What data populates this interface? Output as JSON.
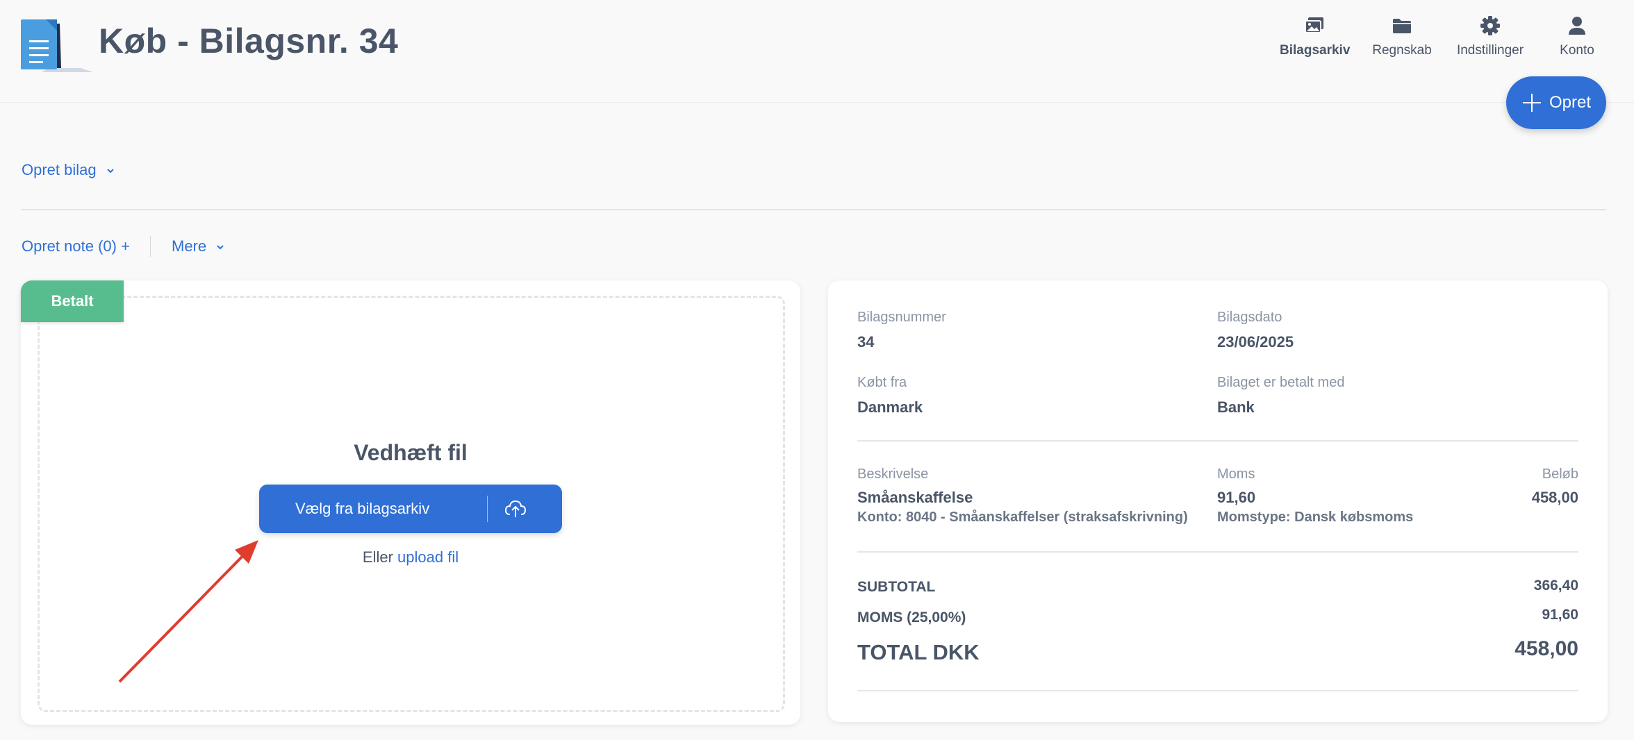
{
  "header": {
    "title": "Køb - Bilagsnr. 34",
    "nav": [
      {
        "label": "Bilagsarkiv",
        "icon": "images-icon",
        "active": true
      },
      {
        "label": "Regnskab",
        "icon": "folder-icon",
        "active": false
      },
      {
        "label": "Indstillinger",
        "icon": "gear-icon",
        "active": false
      },
      {
        "label": "Konto",
        "icon": "user-icon",
        "active": false
      }
    ]
  },
  "fab": {
    "label": "Opret",
    "icon": "plus-icon"
  },
  "toolbar": {
    "create_voucher": "Opret bilag",
    "create_note": "Opret note (0) +",
    "more": "Mere"
  },
  "attachment": {
    "status_badge": "Betalt",
    "title": "Vedhæft fil",
    "choose_button": "Vælg fra bilagsarkiv",
    "upload_prefix": "Eller",
    "upload_link": "upload fil"
  },
  "details": {
    "voucher_number_label": "Bilagsnummer",
    "voucher_number": "34",
    "voucher_date_label": "Bilagsdato",
    "voucher_date": "23/06/2025",
    "bought_from_label": "Købt fra",
    "bought_from": "Danmark",
    "paid_with_label": "Bilaget er betalt med",
    "paid_with": "Bank",
    "line_headers": {
      "description": "Beskrivelse",
      "vat": "Moms",
      "amount": "Beløb"
    },
    "line": {
      "description": "Småanskaffelse",
      "account": "Konto: 8040 - Småanskaffelser (straksafskrivning)",
      "vat": "91,60",
      "vat_type": "Momstype: Dansk købsmoms",
      "amount": "458,00"
    },
    "totals": {
      "subtotal_label": "SUBTOTAL",
      "subtotal": "366,40",
      "vat_label": "MOMS (25,00%)",
      "vat": "91,60",
      "total_label": "TOTAL DKK",
      "total": "458,00"
    }
  },
  "colors": {
    "accent": "#2f6fd6",
    "paid": "#57bd8f",
    "arrow": "#e03c2e"
  }
}
